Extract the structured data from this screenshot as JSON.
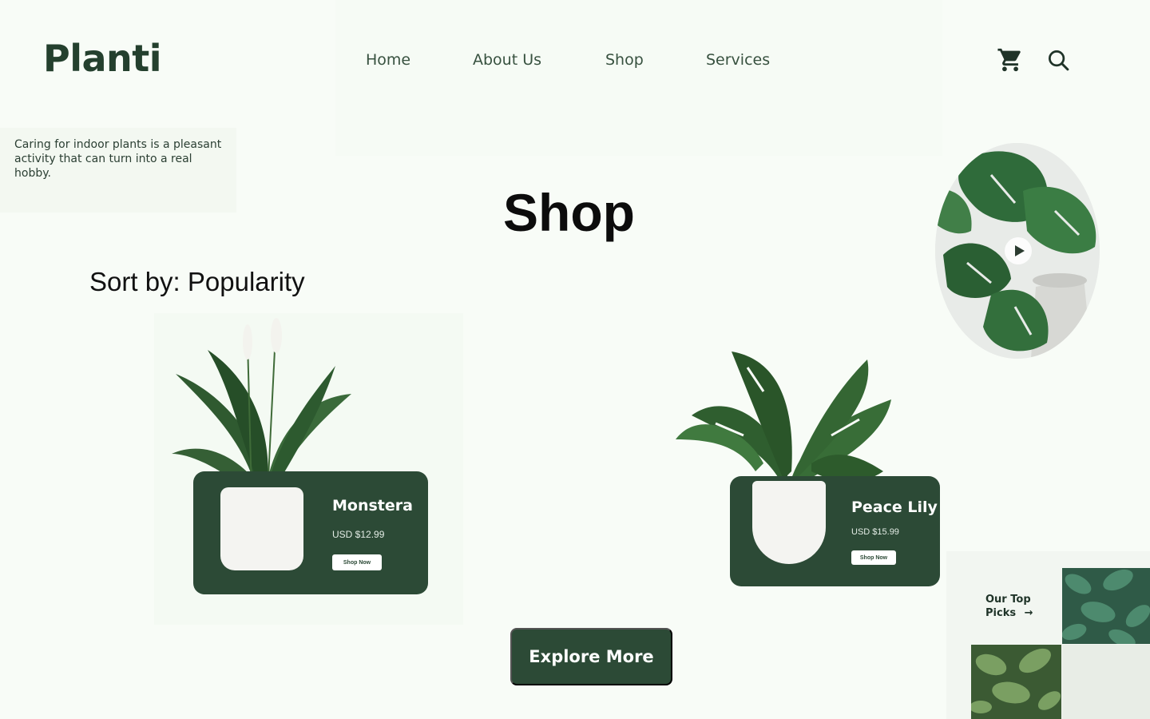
{
  "brand": {
    "logo": "Planti"
  },
  "nav": {
    "items": [
      {
        "label": "Home"
      },
      {
        "label": "About Us"
      },
      {
        "label": "Shop"
      },
      {
        "label": "Services"
      }
    ]
  },
  "tagline": "Caring for indoor plants is a pleasant activity that can turn into a real hobby.",
  "page": {
    "title": "Shop",
    "sort_label": "Sort by: Popularity"
  },
  "products": [
    {
      "name": "Monstera",
      "price": "USD $12.99",
      "cta": "Shop Now"
    },
    {
      "name": "Peace Lily",
      "price": "USD $15.99",
      "cta": "Shop Now"
    }
  ],
  "explore": {
    "label": "Explore More"
  },
  "top_picks": {
    "label_line1": "Our Top",
    "label_line2": "Picks",
    "arrow": "→"
  },
  "colors": {
    "background": "#f8fcf7",
    "accent": "#2c4a36",
    "text_dark": "#24402e"
  },
  "icons": [
    "cart-icon",
    "search-icon",
    "play-icon",
    "arrow-right-icon"
  ]
}
